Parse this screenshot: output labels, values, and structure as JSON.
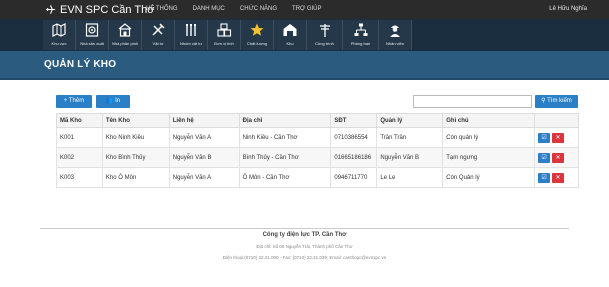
{
  "app": {
    "title": "EVN SPC Cần Thơ"
  },
  "topnav": [
    "HỆ THỐNG",
    "DANH MỤC",
    "CHỨC NĂNG",
    "TRỢ GIÚP"
  ],
  "user": {
    "name": "Lê Hữu Nghĩa"
  },
  "toolbar": [
    {
      "label": "Khu vực",
      "icon": "map-icon"
    },
    {
      "label": "Nhà sản xuất",
      "icon": "factory-icon"
    },
    {
      "label": "Nhà phân phối",
      "icon": "store-icon"
    },
    {
      "label": "Vật tư",
      "icon": "tools-icon"
    },
    {
      "label": "Nhóm vật tư",
      "icon": "tool-group-icon"
    },
    {
      "label": "Đơn vị tính",
      "icon": "boxes-icon"
    },
    {
      "label": "Chất lượng",
      "icon": "star-icon"
    },
    {
      "label": "Kho",
      "icon": "warehouse-icon"
    },
    {
      "label": "Công trình",
      "icon": "power-pole-icon"
    },
    {
      "label": "Phòng ban",
      "icon": "org-chart-icon"
    },
    {
      "label": "Nhân viên",
      "icon": "worker-icon"
    }
  ],
  "page": {
    "title": "QUẢN LÝ KHO"
  },
  "actions": {
    "add": "+ Thêm",
    "print": "In",
    "search_placeholder": "",
    "search_button": "Tìm kiếm"
  },
  "table": {
    "columns": [
      "Mã Kho",
      "Tên Kho",
      "Liên hệ",
      "Địa chỉ",
      "SĐT",
      "Quản lý",
      "Ghi chú",
      ""
    ],
    "rows": [
      [
        "K001",
        "Kho Ninh Kiều",
        "Nguyễn Văn A",
        "Ninh Kiều - Cần Thơ",
        "0710386554",
        "Trần Trần",
        "Còn quản lý"
      ],
      [
        "K002",
        "Kho Bình Thủy",
        "Nguyễn Văn B",
        "Bình Thủy - Cần Thơ",
        "01665186186",
        "Nguyễn Văn B",
        "Tạm ngưng"
      ],
      [
        "K003",
        "Kho Ô Môn",
        "Nguyễn Văn A",
        "Ô Môn - Cần Thơ",
        "0946711770",
        "Le Le",
        "Còn Quản lý"
      ]
    ],
    "row_actions": {
      "edit": "☑",
      "delete": "✕"
    }
  },
  "footer": {
    "company": "Công ty điện lực TP. Cần Thơ",
    "address": "Địa chỉ: Số 06 Nguyễn Trãi, Thành phố Cần Thơ",
    "contact": "Điện thoại:(0710) 22.21.000 - Fax: (0710) 22.21.039; Email: canthopc@evnspc.vn"
  },
  "colors": {
    "topbar": "#2b2b2b",
    "toolbar": "#1a2e3f",
    "header": "#2c5b80",
    "primary": "#2a7fc6",
    "danger": "#d9363e"
  }
}
